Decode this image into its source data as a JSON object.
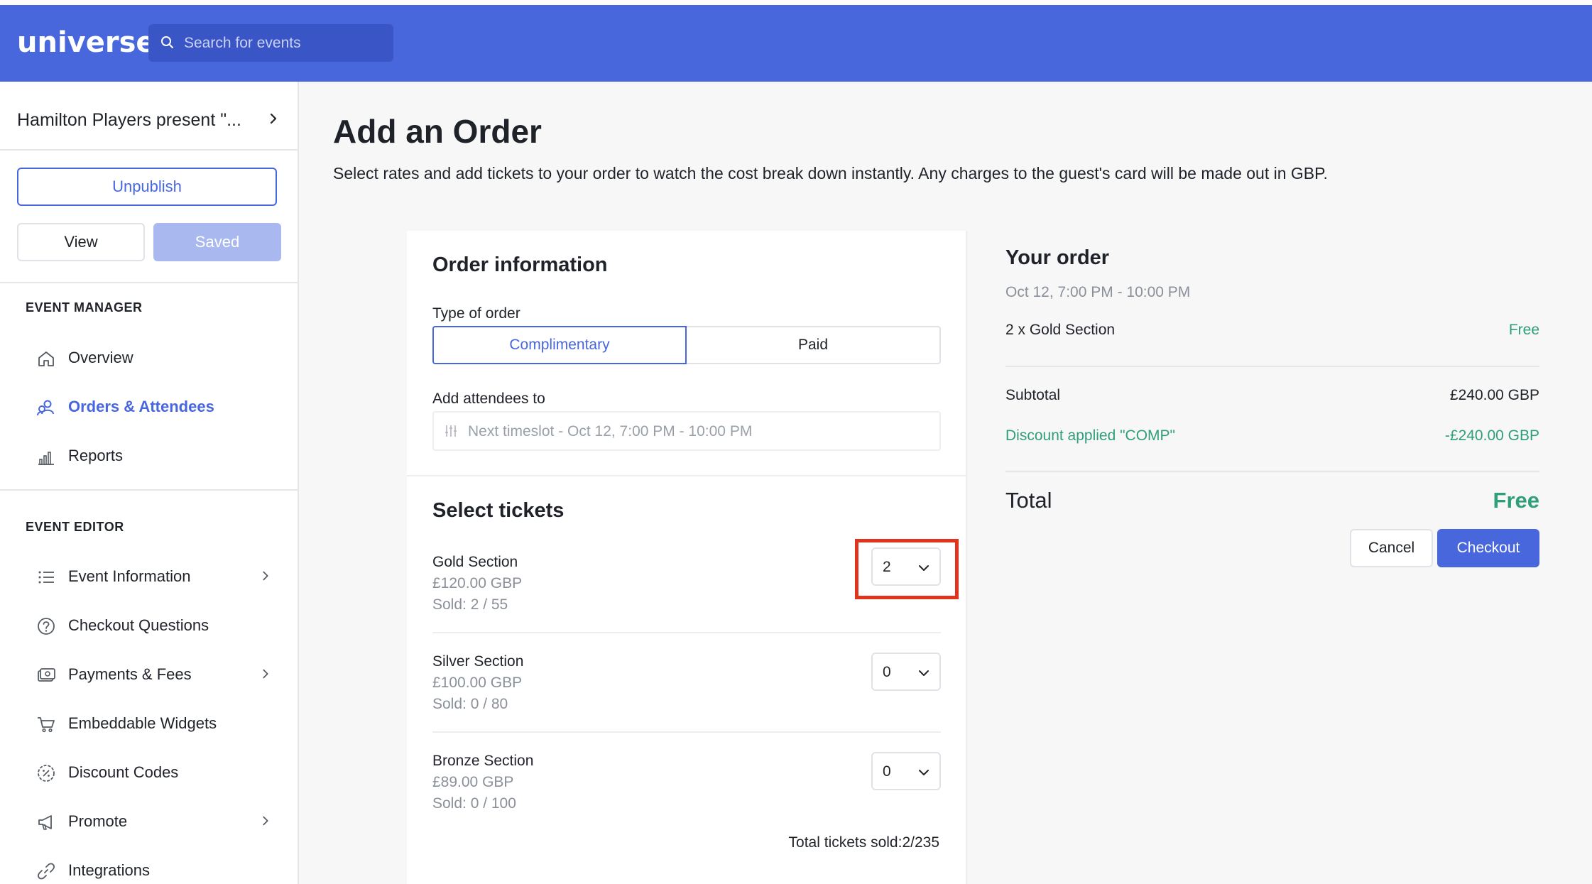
{
  "header": {
    "logo": "universe",
    "search_placeholder": "Search for events"
  },
  "sidebar": {
    "event_name": "Hamilton Players present \"...",
    "unpublish_label": "Unpublish",
    "view_label": "View",
    "saved_label": "Saved",
    "event_manager_label": "EVENT MANAGER",
    "manager_items": [
      {
        "label": "Overview",
        "icon": "home-icon"
      },
      {
        "label": "Orders & Attendees",
        "icon": "attendees-icon",
        "active": true
      },
      {
        "label": "Reports",
        "icon": "bar-chart-icon"
      }
    ],
    "event_editor_label": "EVENT EDITOR",
    "editor_items": [
      {
        "label": "Event Information",
        "icon": "list-icon",
        "has_chevron": true
      },
      {
        "label": "Checkout Questions",
        "icon": "question-icon"
      },
      {
        "label": "Payments & Fees",
        "icon": "payment-icon",
        "has_chevron": true
      },
      {
        "label": "Embeddable Widgets",
        "icon": "cart-icon"
      },
      {
        "label": "Discount Codes",
        "icon": "discount-icon"
      },
      {
        "label": "Promote",
        "icon": "megaphone-icon",
        "has_chevron": true
      },
      {
        "label": "Integrations",
        "icon": "link-icon"
      }
    ]
  },
  "main": {
    "title": "Add an Order",
    "description": "Select rates and add tickets to your order to watch the cost break down instantly. Any charges to the guest's card will be made out in GBP.",
    "order_info": {
      "title": "Order information",
      "type_label": "Type of order",
      "type_options": [
        "Complimentary",
        "Paid"
      ],
      "type_selected": "Complimentary",
      "attendees_label": "Add attendees to",
      "timeslot_value": "Next timeslot - Oct 12, 7:00 PM - 10:00 PM"
    },
    "tickets": {
      "title": "Select tickets",
      "items": [
        {
          "name": "Gold Section",
          "price": "£120.00 GBP",
          "sold": "Sold: 2 / 55",
          "quantity": "2"
        },
        {
          "name": "Silver Section",
          "price": "£100.00 GBP",
          "sold": "Sold: 0 / 80",
          "quantity": "0"
        },
        {
          "name": "Bronze Section",
          "price": "£89.00 GBP",
          "sold": "Sold: 0 / 100",
          "quantity": "0"
        }
      ],
      "total_sold": "Total tickets sold:2/235"
    }
  },
  "summary": {
    "title": "Your order",
    "date": "Oct 12, 7:00 PM - 10:00 PM",
    "line_item": "2 x Gold Section",
    "line_price": "Free",
    "subtotal_label": "Subtotal",
    "subtotal_value": "£240.00 GBP",
    "discount_label": "Discount applied \"COMP\"",
    "discount_value": "-£240.00 GBP",
    "total_label": "Total",
    "total_value": "Free",
    "cancel_label": "Cancel",
    "checkout_label": "Checkout"
  },
  "colors": {
    "brand": "#4867dd",
    "success": "#2f9e7a",
    "highlight": "#e0341e"
  }
}
